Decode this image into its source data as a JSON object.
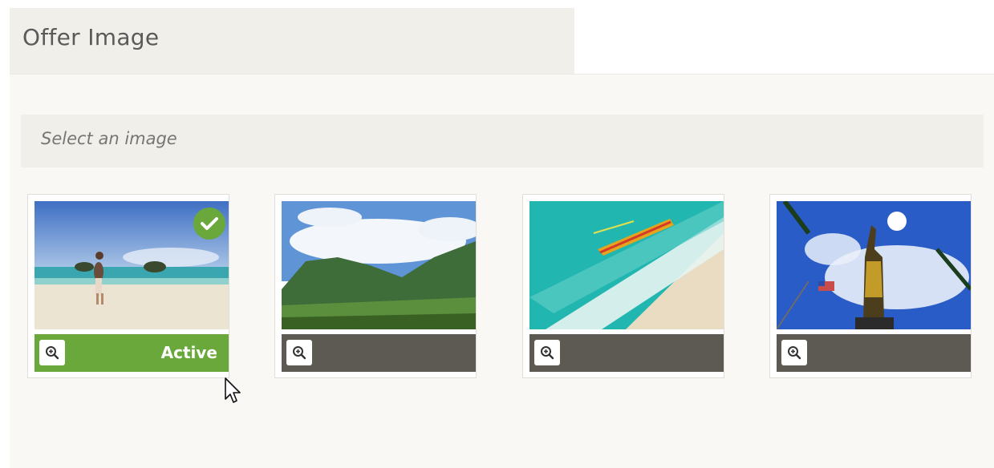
{
  "section": {
    "title": "Offer Image"
  },
  "picker": {
    "prompt": "Select an image",
    "images": [
      {
        "name": "beach-walker",
        "status_label": "Active",
        "selected": true
      },
      {
        "name": "green-mountains",
        "status_label": "",
        "selected": false
      },
      {
        "name": "outrigger-canoe",
        "status_label": "",
        "selected": false
      },
      {
        "name": "kamehameha-statue",
        "status_label": "",
        "selected": false
      }
    ]
  },
  "icons": {
    "zoom": "zoom-in-icon",
    "check": "check-icon",
    "cursor": "mouse-cursor-icon"
  },
  "colors": {
    "active_green": "#6aa83c",
    "inactive_bar": "#5c5a52",
    "header_bg": "#f1efe9",
    "panel_bg": "#faf8f4"
  }
}
